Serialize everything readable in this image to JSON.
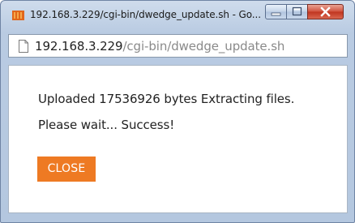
{
  "window": {
    "title": "192.168.3.229/cgi-bin/dwedge_update.sh - Go..."
  },
  "address_bar": {
    "url_host": "192.168.3.229",
    "url_path": "/cgi-bin/dwedge_update.sh"
  },
  "content": {
    "line1": "Uploaded 17536926 bytes Extracting files.",
    "line2": "Please wait... Success!",
    "close_button_label": "CLOSE"
  },
  "colors": {
    "close_button": "#ee7a23",
    "window_frame": "#b9cbe2",
    "close_control": "#c0341f"
  },
  "icons": {
    "app": "browser-app-icon",
    "page": "page-icon",
    "minimize": "minimize-icon",
    "maximize": "maximize-icon",
    "close": "close-icon"
  }
}
